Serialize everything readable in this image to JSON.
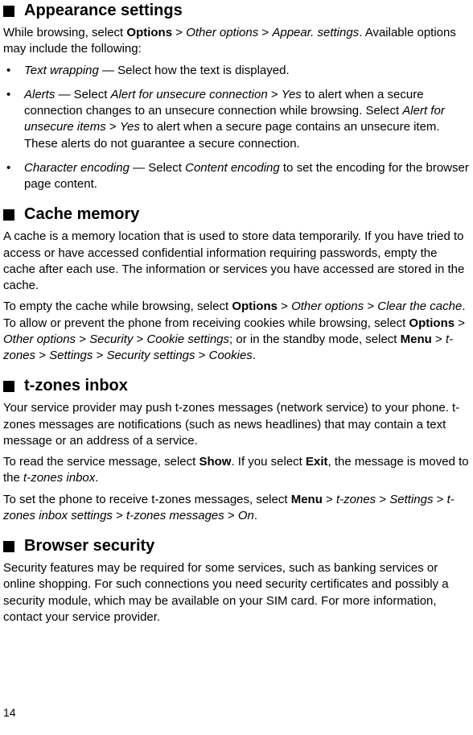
{
  "sections": {
    "appearance": {
      "title": "Appearance settings",
      "intro_pre": "While browsing, select ",
      "intro_b1": "Options",
      "intro_mid1": " > ",
      "intro_i1": "Other options",
      "intro_mid2": " > ",
      "intro_i2": "Appear. settings",
      "intro_post": ". Available options may include the following:",
      "item1_i": "Text wrapping",
      "item1_rest": " — Select how the text is displayed.",
      "item2_i1": "Alerts",
      "item2_t1": " — Select ",
      "item2_i2": "Alert for unsecure connection",
      "item2_t2": " > ",
      "item2_i3": "Yes",
      "item2_t3": " to alert when a secure connection changes to an unsecure connection while browsing. Select ",
      "item2_i4": "Alert for unsecure items",
      "item2_t4": " > ",
      "item2_i5": "Yes",
      "item2_t5": " to alert when a secure page contains an unsecure item. These alerts do not guarantee a secure connection.",
      "item3_i1": "Character encoding",
      "item3_t1": " — Select ",
      "item3_i2": "Content encoding",
      "item3_t2": " to set the encoding for the browser page content."
    },
    "cache": {
      "title": "Cache memory",
      "p1": "A cache is a memory location that is used to store data temporarily. If you have tried to access or have accessed confidential information requiring passwords, empty the cache after each use. The information or services you have accessed are stored in the cache.",
      "p2_t1": "To empty the cache while browsing, select ",
      "p2_b1": "Options",
      "p2_t2": " > ",
      "p2_i1": "Other options",
      "p2_t3": " > ",
      "p2_i2": "Clear the cache",
      "p2_t4": ". To allow or prevent the phone from receiving cookies while browsing, select ",
      "p2_b2": "Options",
      "p2_t5": " > ",
      "p2_i3": "Other options",
      "p2_t6": " > ",
      "p2_i4": "Security",
      "p2_t7": " > ",
      "p2_i5": "Cookie settings",
      "p2_t8": "; or in the standby mode, select ",
      "p2_b3": "Menu",
      "p2_t9": " > ",
      "p2_i6": "t-zones",
      "p2_t10": " > ",
      "p2_i7": "Settings",
      "p2_t11": " > ",
      "p2_i8": "Security settings",
      "p2_t12": " > ",
      "p2_i9": "Cookies",
      "p2_t13": "."
    },
    "tzones": {
      "title": "t-zones inbox",
      "p1": "Your service provider may push t-zones messages (network service) to your phone. t-zones messages are notifications (such as news headlines) that may contain a text message or an address of a service.",
      "p2_t1": "To read the service message, select ",
      "p2_b1": "Show",
      "p2_t2": ". If you select ",
      "p2_b2": "Exit",
      "p2_t3": ", the message is moved to the ",
      "p2_i1": "t-zones inbox",
      "p2_t4": ".",
      "p3_t1": "To set the phone to receive t-zones messages, select ",
      "p3_b1": "Menu",
      "p3_t2": " > ",
      "p3_i1": "t-zones",
      "p3_t3": " > ",
      "p3_i2": "Settings",
      "p3_t4": " > ",
      "p3_i3": "t-zones inbox settings",
      "p3_t5": " > ",
      "p3_i4": "t-zones messages",
      "p3_t6": " > ",
      "p3_i5": "On",
      "p3_t7": "."
    },
    "security": {
      "title": "Browser security",
      "p1": "Security features may be required for some services, such as banking services or online shopping. For such connections you need security certificates and possibly a security module, which may be available on your SIM card. For more information, contact your service provider."
    }
  },
  "page_number": "14"
}
